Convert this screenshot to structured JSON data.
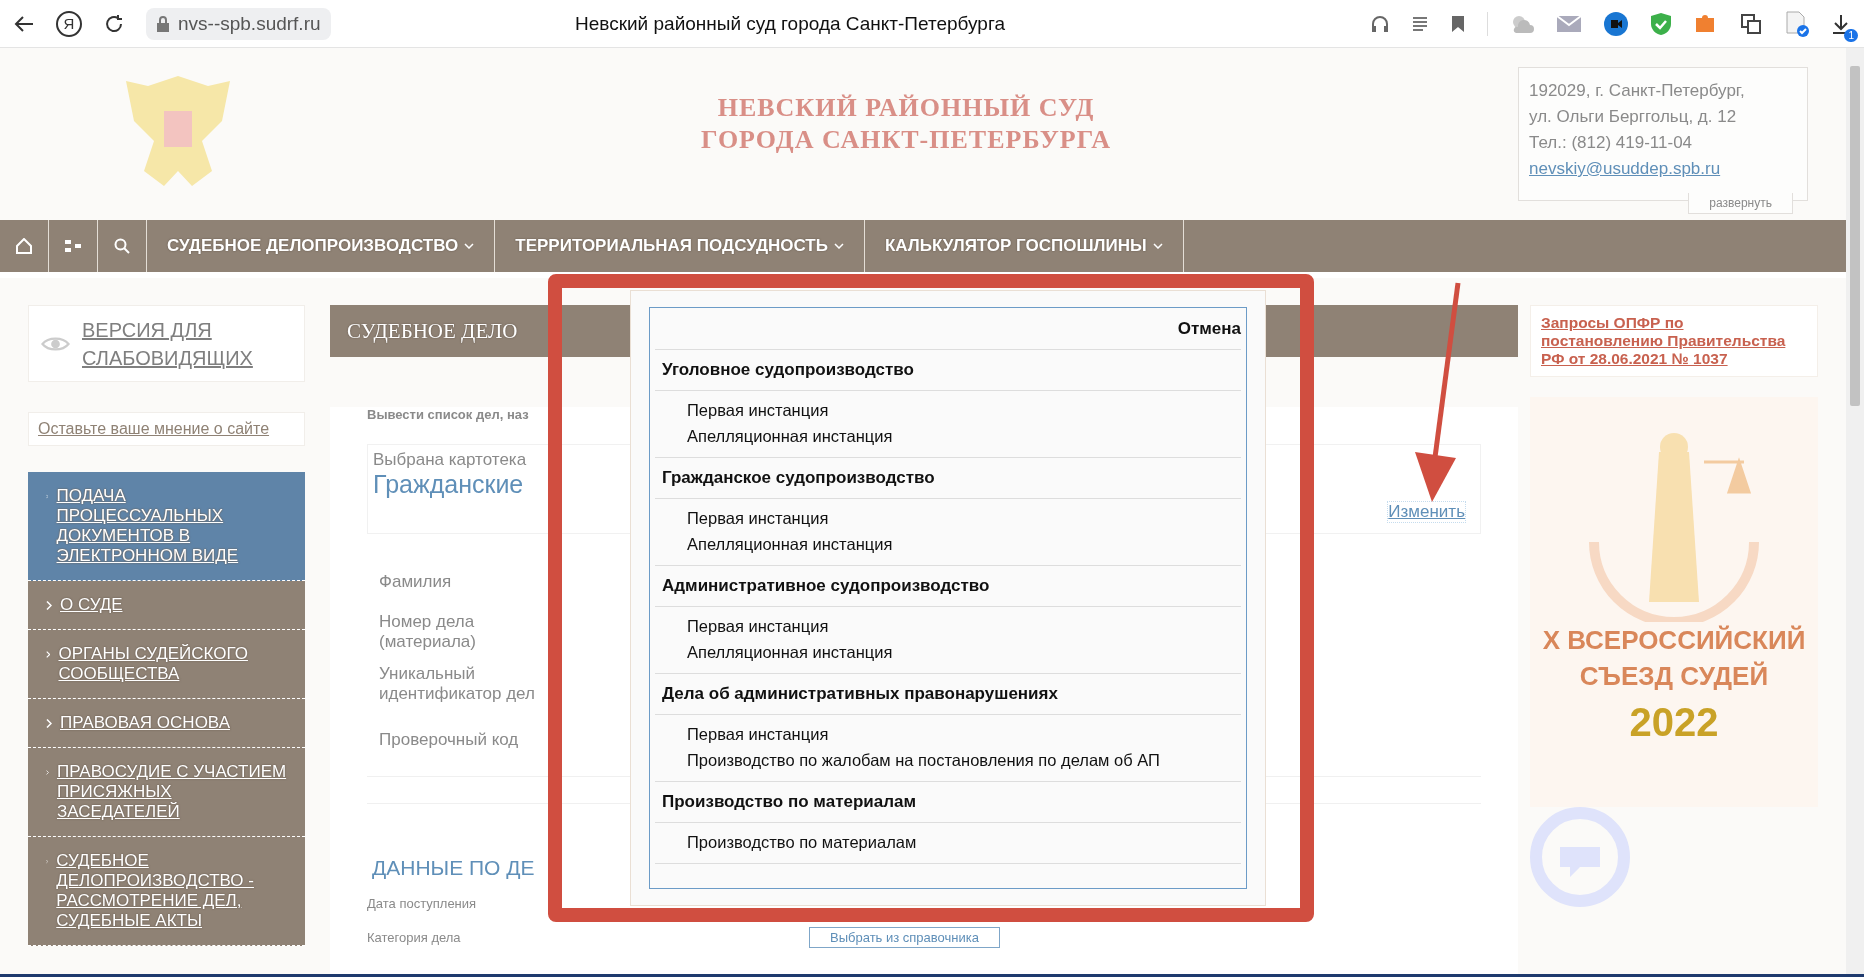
{
  "browser": {
    "logo": "Я",
    "address": "nvs--spb.sudrf.ru",
    "title": "Невский районный суд города Санкт-Петербурга",
    "download_badge": "1"
  },
  "header": {
    "title_lines": [
      "НЕВСКИЙ РАЙОННЫЙ СУД",
      "ГОРОДА САНКТ-ПЕТЕРБУРГА"
    ],
    "contact": {
      "lines": [
        "192029, г. Санкт-Петербург,",
        "ул. Ольги Берггольц, д. 12",
        "Тел.: (812) 419-11-04"
      ],
      "email": "nevskiy@usuddep.spb.ru",
      "expand": "развернуть"
    }
  },
  "nav": {
    "items": [
      "СУДЕБНОЕ ДЕЛОПРОИЗВОДСТВО",
      "ТЕРРИТОРИАЛЬНАЯ ПОДСУДНОСТЬ",
      "КАЛЬКУЛЯТОР ГОСПОШЛИНЫ"
    ]
  },
  "sidebar": {
    "accessibility": "ВЕРСИЯ ДЛЯ СЛАБОВИДЯЩИХ",
    "feedback": "Оставьте ваше мнение о сайте",
    "menu": [
      {
        "label": "ПОДАЧА ПРОЦЕССУАЛЬНЫХ ДОКУМЕНТОВ В ЭЛЕКТРОННОМ ВИДЕ",
        "selected": true
      },
      {
        "label": "О СУДЕ",
        "selected": false
      },
      {
        "label": "ОРГАНЫ СУДЕЙСКОГО СООБЩЕСТВА",
        "selected": false
      },
      {
        "label": "ПРАВОВАЯ ОСНОВА",
        "selected": false
      },
      {
        "label": "ПРАВОСУДИЕ С УЧАСТИЕМ ПРИСЯЖНЫХ ЗАСЕДАТЕЛЕЙ",
        "selected": false
      },
      {
        "label": "СУДЕБНОЕ ДЕЛОПРОИЗВОДСТВО - РАССМОТРЕНИЕ ДЕЛ, СУДЕБНЫЕ АКТЫ",
        "selected": false
      }
    ]
  },
  "content": {
    "heading": "СУДЕБНОЕ ДЕЛО",
    "list_hint": "Вывести список дел, наз",
    "selected_label": "Выбрана картотека",
    "selected_value": "Гражданские",
    "change_link": "Изменить",
    "fields": [
      "Фамилия",
      "Номер дела (материала)",
      "Уникальный идентификатор дел",
      "Проверочный код"
    ],
    "section": "ДАННЫЕ ПО ДЕ",
    "filters": [
      "Дата поступления",
      "Категория дела"
    ],
    "pick_button": "Выбрать из справочника"
  },
  "right": {
    "notice": "Запросы ОПФР по постановлению Правительства РФ от 28.06.2021 № 1037",
    "banner": [
      "X ВСЕРОССИЙСКИЙ",
      "СЪЕЗД СУДЕЙ",
      "2022"
    ]
  },
  "dialog": {
    "cancel": "Отмена",
    "groups": [
      {
        "title": "Уголовное судопроизводство",
        "items": [
          "Первая инстанция",
          "Апелляционная инстанция"
        ]
      },
      {
        "title": "Гражданское судопроизводство",
        "items": [
          "Первая инстанция",
          "Апелляционная инстанция"
        ]
      },
      {
        "title": "Административное судопроизводство",
        "items": [
          "Первая инстанция",
          "Апелляционная инстанция"
        ]
      },
      {
        "title": "Дела об административных правонарушениях",
        "items": [
          "Первая инстанция",
          "Производство по жалобам на постановления по делам об АП"
        ]
      },
      {
        "title": "Производство по материалам",
        "items": [
          "Производство по материалам"
        ]
      }
    ]
  }
}
